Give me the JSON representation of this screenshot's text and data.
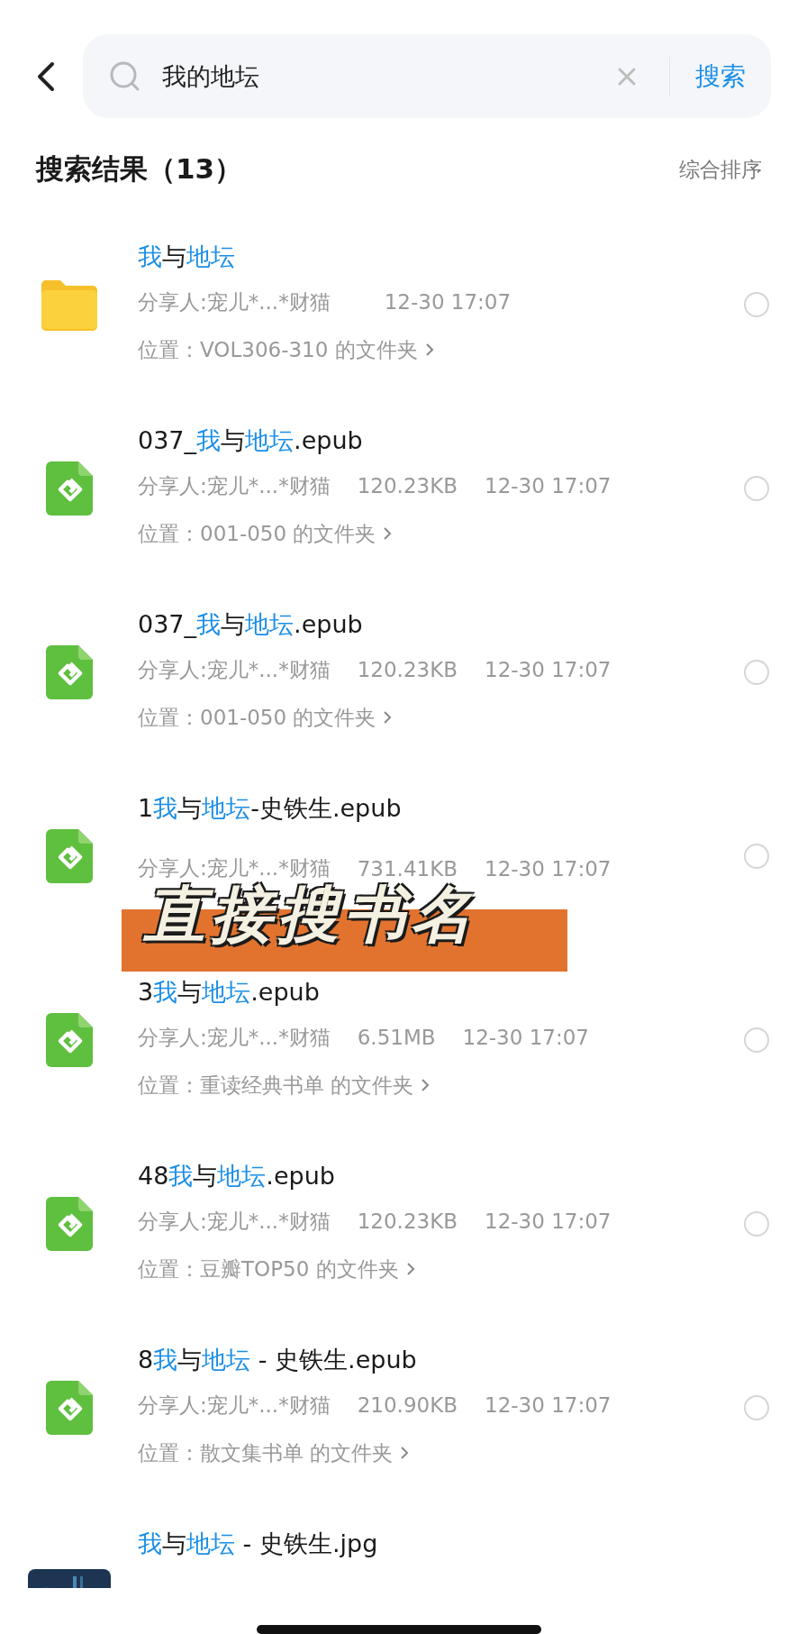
{
  "search": {
    "value": "我的地坛",
    "button": "搜索"
  },
  "results": {
    "title": "搜索结果（13）",
    "sort": "综合排序"
  },
  "rows": [
    {
      "kind": "folder",
      "title": [
        {
          "text": "我",
          "highlight": true
        },
        {
          "text": "与",
          "highlight": false
        },
        {
          "text": "地坛",
          "highlight": true
        }
      ],
      "sharer": "分享人:宠儿*...*财猫",
      "time": "12-30 17:07",
      "location": "位置：VOL306-310 的文件夹",
      "selected": false
    },
    {
      "kind": "epub",
      "title": [
        {
          "text": "037_",
          "highlight": false
        },
        {
          "text": "我",
          "highlight": true
        },
        {
          "text": "与",
          "highlight": false
        },
        {
          "text": "地坛",
          "highlight": true
        },
        {
          "text": ".epub",
          "highlight": false
        }
      ],
      "sharer": "分享人:宠儿*...*财猫",
      "size": "120.23KB",
      "time": "12-30 17:07",
      "location": "位置：001-050 的文件夹",
      "selected": false
    },
    {
      "kind": "epub",
      "title": [
        {
          "text": "037_",
          "highlight": false
        },
        {
          "text": "我",
          "highlight": true
        },
        {
          "text": "与",
          "highlight": false
        },
        {
          "text": "地坛",
          "highlight": true
        },
        {
          "text": ".epub",
          "highlight": false
        }
      ],
      "sharer": "分享人:宠儿*...*财猫",
      "size": "120.23KB",
      "time": "12-30 17:07",
      "location": "位置：001-050 的文件夹",
      "selected": false
    },
    {
      "kind": "epub",
      "title": [
        {
          "text": "1",
          "highlight": false
        },
        {
          "text": "我",
          "highlight": true
        },
        {
          "text": "与",
          "highlight": false
        },
        {
          "text": "地坛",
          "highlight": true
        },
        {
          "text": "-史铁生.epub",
          "highlight": false
        }
      ],
      "sharer": "分享人:宠儿*...*财猫",
      "size": "731.41KB",
      "time": "12-30 17:07",
      "selected": false
    },
    {
      "kind": "epub",
      "title": [
        {
          "text": "3",
          "highlight": false
        },
        {
          "text": "我",
          "highlight": true
        },
        {
          "text": "与",
          "highlight": false
        },
        {
          "text": "地坛",
          "highlight": true
        },
        {
          "text": ".epub",
          "highlight": false
        }
      ],
      "sharer": "分享人:宠儿*...*财猫",
      "size": "6.51MB",
      "time": "12-30 17:07",
      "location": "位置：重读经典书单 的文件夹",
      "selected": false
    },
    {
      "kind": "epub",
      "title": [
        {
          "text": "48",
          "highlight": false
        },
        {
          "text": "我",
          "highlight": true
        },
        {
          "text": "与",
          "highlight": false
        },
        {
          "text": "地坛",
          "highlight": true
        },
        {
          "text": ".epub",
          "highlight": false
        }
      ],
      "sharer": "分享人:宠儿*...*财猫",
      "size": "120.23KB",
      "time": "12-30 17:07",
      "location": "位置：豆瓣TOP50 的文件夹",
      "selected": false
    },
    {
      "kind": "epub",
      "title": [
        {
          "text": "8",
          "highlight": false
        },
        {
          "text": "我",
          "highlight": true
        },
        {
          "text": "与",
          "highlight": false
        },
        {
          "text": "地坛",
          "highlight": true
        },
        {
          "text": " - 史铁生.epub",
          "highlight": false
        }
      ],
      "sharer": "分享人:宠儿*...*财猫",
      "size": "210.90KB",
      "time": "12-30 17:07",
      "location": "位置：散文集书单 的文件夹",
      "selected": false
    },
    {
      "kind": "picture",
      "title": [
        {
          "text": "我",
          "highlight": true
        },
        {
          "text": "与",
          "highlight": false
        },
        {
          "text": "地坛",
          "highlight": true
        },
        {
          "text": " - 史铁生.jpg",
          "highlight": false
        }
      ]
    }
  ],
  "caption": "直接搜书名"
}
